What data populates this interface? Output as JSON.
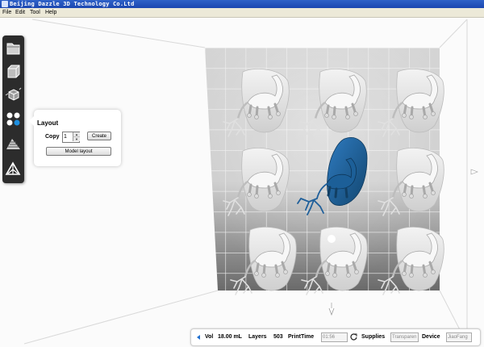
{
  "window": {
    "title": "Beijing Dazzle 3D Technology Co.Ltd"
  },
  "menu": {
    "items": [
      "File",
      "Edit",
      "Tool",
      "Help"
    ]
  },
  "toolbar": {
    "tools": [
      "open-file-icon",
      "view-cube-icon",
      "transform-cube-icon",
      "layout-icon",
      "slice-layers-icon",
      "support-icon"
    ]
  },
  "layout_panel": {
    "title": "Layout",
    "copy_label": "Copy",
    "copy_value": "1",
    "create_label": "Create",
    "model_layout_label": "Model layout"
  },
  "scene": {
    "models": 9,
    "selected_model_color": "#1f5f9a",
    "model_color": "#e6e6e6"
  },
  "status": {
    "vol_label": "Vol",
    "vol_value": "18.00 mL",
    "layers_label": "Layers",
    "layers_value": "503",
    "printtime_label": "PrintTime",
    "printtime_value": "01:56",
    "supplies_label": "Supplies",
    "supplies_value": "Transparen",
    "device_label": "Device",
    "device_value": "JiaoFang"
  }
}
